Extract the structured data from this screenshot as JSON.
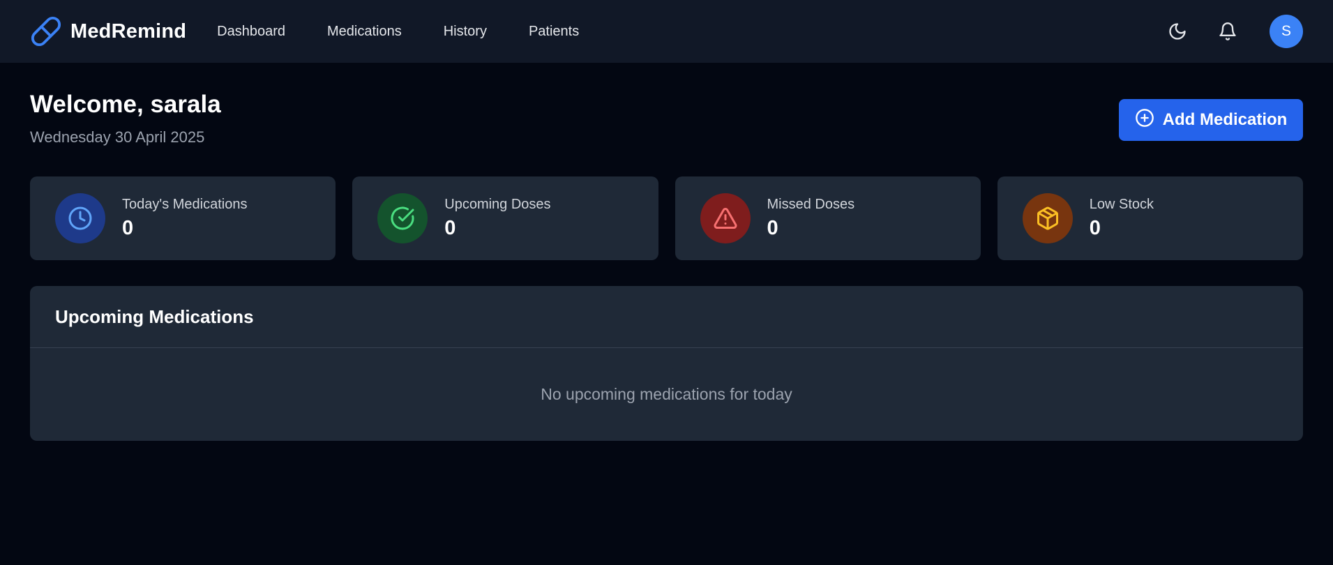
{
  "brand": {
    "name": "MedRemind",
    "icon": "pill-icon",
    "color": "#3b82f6"
  },
  "nav": {
    "items": [
      {
        "label": "Dashboard"
      },
      {
        "label": "Medications"
      },
      {
        "label": "History"
      },
      {
        "label": "Patients"
      }
    ]
  },
  "header_actions": {
    "theme_icon": "moon-icon",
    "notifications_icon": "bell-icon",
    "avatar_initial": "S"
  },
  "welcome": {
    "title": "Welcome, sarala",
    "date": "Wednesday 30 April 2025",
    "add_button_label": "Add Medication",
    "add_button_icon": "plus-circle-icon"
  },
  "stats": [
    {
      "label": "Today's Medications",
      "value": "0",
      "icon": "clock-icon",
      "bg": "#1e3a8a",
      "fg": "#60a5fa"
    },
    {
      "label": "Upcoming Doses",
      "value": "0",
      "icon": "check-circle-icon",
      "bg": "#14532d",
      "fg": "#4ade80"
    },
    {
      "label": "Missed Doses",
      "value": "0",
      "icon": "alert-triangle-icon",
      "bg": "#7f1d1d",
      "fg": "#f87171"
    },
    {
      "label": "Low Stock",
      "value": "0",
      "icon": "package-icon",
      "bg": "#78350f",
      "fg": "#fbbf24"
    }
  ],
  "upcoming": {
    "title": "Upcoming Medications",
    "empty_text": "No upcoming medications for today"
  },
  "colors": {
    "background": "#030712",
    "navbar": "#111827",
    "card": "#1f2937",
    "primary": "#2563eb"
  }
}
